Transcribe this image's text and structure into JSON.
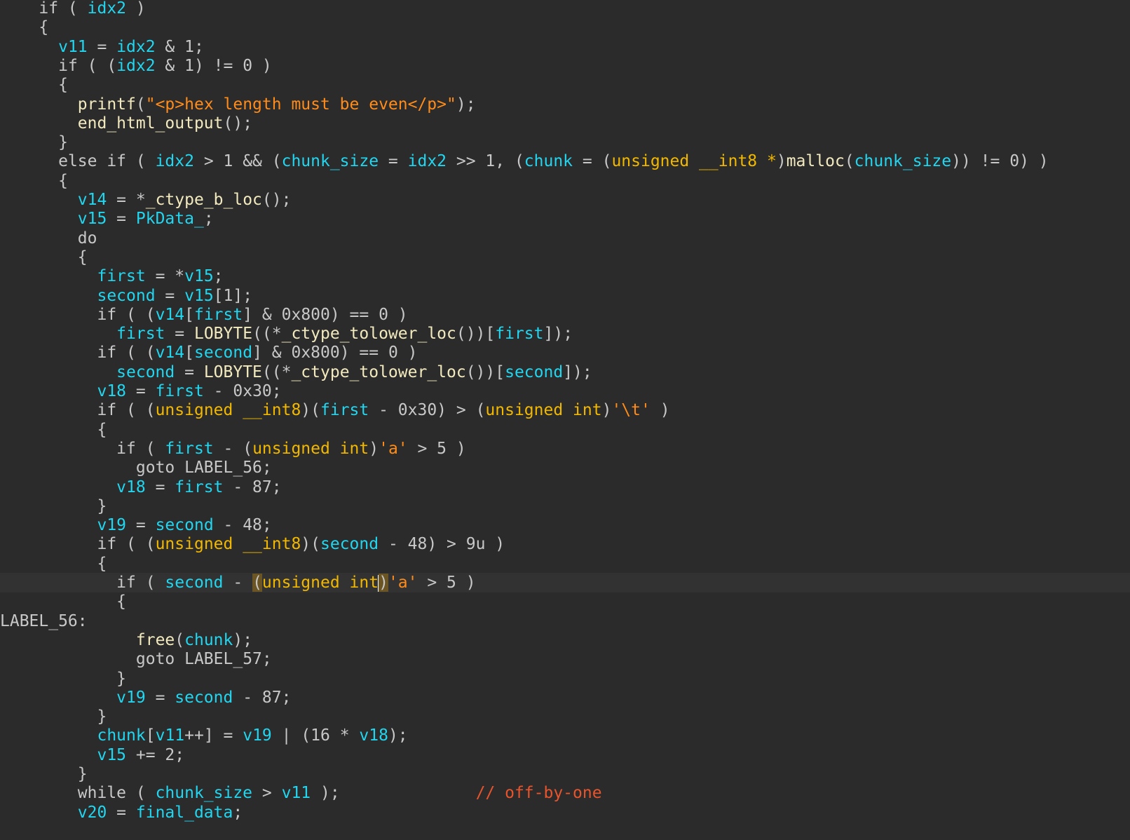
{
  "editor": {
    "current_line": 30,
    "lines": [
      {
        "indent": 2,
        "tokens": [
          [
            "plain",
            "if ( "
          ],
          [
            "var",
            "idx2"
          ],
          [
            "plain",
            " )"
          ]
        ]
      },
      {
        "indent": 2,
        "tokens": [
          [
            "plain",
            "{"
          ]
        ]
      },
      {
        "indent": 3,
        "tokens": [
          [
            "var",
            "v11"
          ],
          [
            "plain",
            " = "
          ],
          [
            "var",
            "idx2"
          ],
          [
            "plain",
            " & 1;"
          ]
        ]
      },
      {
        "indent": 3,
        "tokens": [
          [
            "plain",
            "if ( ("
          ],
          [
            "var",
            "idx2"
          ],
          [
            "plain",
            " & 1) != 0 )"
          ]
        ]
      },
      {
        "indent": 3,
        "tokens": [
          [
            "plain",
            "{"
          ]
        ]
      },
      {
        "indent": 4,
        "tokens": [
          [
            "func",
            "printf"
          ],
          [
            "plain",
            "("
          ],
          [
            "str",
            "\"<p>hex length must be even</p>\""
          ],
          [
            "plain",
            ");"
          ]
        ]
      },
      {
        "indent": 4,
        "tokens": [
          [
            "func",
            "end_html_output"
          ],
          [
            "plain",
            "();"
          ]
        ]
      },
      {
        "indent": 3,
        "tokens": [
          [
            "plain",
            "}"
          ]
        ]
      },
      {
        "indent": 3,
        "tokens": [
          [
            "plain",
            "else if ( "
          ],
          [
            "var",
            "idx2"
          ],
          [
            "plain",
            " > 1 && ("
          ],
          [
            "var",
            "chunk_size"
          ],
          [
            "plain",
            " = "
          ],
          [
            "var",
            "idx2"
          ],
          [
            "plain",
            " >> 1, ("
          ],
          [
            "var",
            "chunk"
          ],
          [
            "plain",
            " = ("
          ],
          [
            "type",
            "unsigned __int8 *"
          ],
          [
            "plain",
            ")"
          ],
          [
            "func",
            "malloc"
          ],
          [
            "plain",
            "("
          ],
          [
            "var",
            "chunk_size"
          ],
          [
            "plain",
            ")) != 0) )"
          ]
        ]
      },
      {
        "indent": 3,
        "tokens": [
          [
            "plain",
            "{"
          ]
        ]
      },
      {
        "indent": 4,
        "tokens": [
          [
            "var",
            "v14"
          ],
          [
            "plain",
            " = *"
          ],
          [
            "func",
            "_ctype_b_loc"
          ],
          [
            "plain",
            "();"
          ]
        ]
      },
      {
        "indent": 4,
        "tokens": [
          [
            "var",
            "v15"
          ],
          [
            "plain",
            " = "
          ],
          [
            "var",
            "PkData_"
          ],
          [
            "plain",
            ";"
          ]
        ]
      },
      {
        "indent": 4,
        "tokens": [
          [
            "plain",
            "do"
          ]
        ]
      },
      {
        "indent": 4,
        "tokens": [
          [
            "plain",
            "{"
          ]
        ]
      },
      {
        "indent": 5,
        "tokens": [
          [
            "var",
            "first"
          ],
          [
            "plain",
            " = *"
          ],
          [
            "var",
            "v15"
          ],
          [
            "plain",
            ";"
          ]
        ]
      },
      {
        "indent": 5,
        "tokens": [
          [
            "var",
            "second"
          ],
          [
            "plain",
            " = "
          ],
          [
            "var",
            "v15"
          ],
          [
            "plain",
            "[1];"
          ]
        ]
      },
      {
        "indent": 5,
        "tokens": [
          [
            "plain",
            "if ( ("
          ],
          [
            "var",
            "v14"
          ],
          [
            "plain",
            "["
          ],
          [
            "var",
            "first"
          ],
          [
            "plain",
            "] & 0x800) == 0 )"
          ]
        ]
      },
      {
        "indent": 6,
        "tokens": [
          [
            "var",
            "first"
          ],
          [
            "plain",
            " = "
          ],
          [
            "func",
            "LOBYTE"
          ],
          [
            "plain",
            "((*"
          ],
          [
            "func",
            "_ctype_tolower_loc"
          ],
          [
            "plain",
            "())["
          ],
          [
            "var",
            "first"
          ],
          [
            "plain",
            "]);"
          ]
        ]
      },
      {
        "indent": 5,
        "tokens": [
          [
            "plain",
            "if ( ("
          ],
          [
            "var",
            "v14"
          ],
          [
            "plain",
            "["
          ],
          [
            "var",
            "second"
          ],
          [
            "plain",
            "] & 0x800) == 0 )"
          ]
        ]
      },
      {
        "indent": 6,
        "tokens": [
          [
            "var",
            "second"
          ],
          [
            "plain",
            " = "
          ],
          [
            "func",
            "LOBYTE"
          ],
          [
            "plain",
            "((*"
          ],
          [
            "func",
            "_ctype_tolower_loc"
          ],
          [
            "plain",
            "())["
          ],
          [
            "var",
            "second"
          ],
          [
            "plain",
            "]);"
          ]
        ]
      },
      {
        "indent": 5,
        "tokens": [
          [
            "var",
            "v18"
          ],
          [
            "plain",
            " = "
          ],
          [
            "var",
            "first"
          ],
          [
            "plain",
            " - 0x30;"
          ]
        ]
      },
      {
        "indent": 5,
        "tokens": [
          [
            "plain",
            "if ( ("
          ],
          [
            "type",
            "unsigned __int8"
          ],
          [
            "plain",
            ")("
          ],
          [
            "var",
            "first"
          ],
          [
            "plain",
            " - 0x30) > ("
          ],
          [
            "type",
            "unsigned int"
          ],
          [
            "plain",
            ")"
          ],
          [
            "str",
            "'\\t'"
          ],
          [
            "plain",
            " )"
          ]
        ]
      },
      {
        "indent": 5,
        "tokens": [
          [
            "plain",
            "{"
          ]
        ]
      },
      {
        "indent": 6,
        "tokens": [
          [
            "plain",
            "if ( "
          ],
          [
            "var",
            "first"
          ],
          [
            "plain",
            " - ("
          ],
          [
            "type",
            "unsigned int"
          ],
          [
            "plain",
            ")"
          ],
          [
            "str",
            "'a'"
          ],
          [
            "plain",
            " > 5 )"
          ]
        ]
      },
      {
        "indent": 7,
        "tokens": [
          [
            "plain",
            "goto LABEL_56;"
          ]
        ]
      },
      {
        "indent": 6,
        "tokens": [
          [
            "var",
            "v18"
          ],
          [
            "plain",
            " = "
          ],
          [
            "var",
            "first"
          ],
          [
            "plain",
            " - 87;"
          ]
        ]
      },
      {
        "indent": 5,
        "tokens": [
          [
            "plain",
            "}"
          ]
        ]
      },
      {
        "indent": 5,
        "tokens": [
          [
            "var",
            "v19"
          ],
          [
            "plain",
            " = "
          ],
          [
            "var",
            "second"
          ],
          [
            "plain",
            " - 48;"
          ]
        ]
      },
      {
        "indent": 5,
        "tokens": [
          [
            "plain",
            "if ( ("
          ],
          [
            "type",
            "unsigned __int8"
          ],
          [
            "plain",
            ")("
          ],
          [
            "var",
            "second"
          ],
          [
            "plain",
            " - 48) > 9u )"
          ]
        ]
      },
      {
        "indent": 5,
        "tokens": [
          [
            "plain",
            "{"
          ]
        ]
      },
      {
        "indent": 6,
        "tokens": [
          [
            "plain",
            "if ( "
          ],
          [
            "var",
            "second"
          ],
          [
            "plain",
            " - "
          ],
          [
            "hl",
            "("
          ],
          [
            "type",
            "unsigned int"
          ],
          [
            "caret",
            ""
          ],
          [
            "hl",
            ")"
          ],
          [
            "str",
            "'a'"
          ],
          [
            "plain",
            " > 5 )"
          ]
        ]
      },
      {
        "indent": 6,
        "tokens": [
          [
            "plain",
            "{"
          ]
        ]
      },
      {
        "indent": 0,
        "tokens": [
          [
            "plain",
            "LABEL_56:"
          ]
        ]
      },
      {
        "indent": 7,
        "tokens": [
          [
            "func",
            "free"
          ],
          [
            "plain",
            "("
          ],
          [
            "var",
            "chunk"
          ],
          [
            "plain",
            ");"
          ]
        ]
      },
      {
        "indent": 7,
        "tokens": [
          [
            "plain",
            "goto LABEL_57;"
          ]
        ]
      },
      {
        "indent": 6,
        "tokens": [
          [
            "plain",
            "}"
          ]
        ]
      },
      {
        "indent": 6,
        "tokens": [
          [
            "var",
            "v19"
          ],
          [
            "plain",
            " = "
          ],
          [
            "var",
            "second"
          ],
          [
            "plain",
            " - 87;"
          ]
        ]
      },
      {
        "indent": 5,
        "tokens": [
          [
            "plain",
            "}"
          ]
        ]
      },
      {
        "indent": 5,
        "tokens": [
          [
            "var",
            "chunk"
          ],
          [
            "plain",
            "["
          ],
          [
            "var",
            "v11"
          ],
          [
            "plain",
            "++] = "
          ],
          [
            "var",
            "v19"
          ],
          [
            "plain",
            " | (16 * "
          ],
          [
            "var",
            "v18"
          ],
          [
            "plain",
            ");"
          ]
        ]
      },
      {
        "indent": 5,
        "tokens": [
          [
            "var",
            "v15"
          ],
          [
            "plain",
            " += 2;"
          ]
        ]
      },
      {
        "indent": 4,
        "tokens": [
          [
            "plain",
            "}"
          ]
        ]
      },
      {
        "indent": 4,
        "tokens": [
          [
            "plain",
            "while ( "
          ],
          [
            "var",
            "chunk_size"
          ],
          [
            "plain",
            " > "
          ],
          [
            "var",
            "v11"
          ],
          [
            "plain",
            " );"
          ],
          [
            "pad",
            "              "
          ],
          [
            "cmt",
            "// off-by-one"
          ]
        ]
      },
      {
        "indent": 4,
        "tokens": [
          [
            "var",
            "v20"
          ],
          [
            "plain",
            " = "
          ],
          [
            "var",
            "final_data"
          ],
          [
            "plain",
            ";"
          ]
        ]
      }
    ]
  }
}
